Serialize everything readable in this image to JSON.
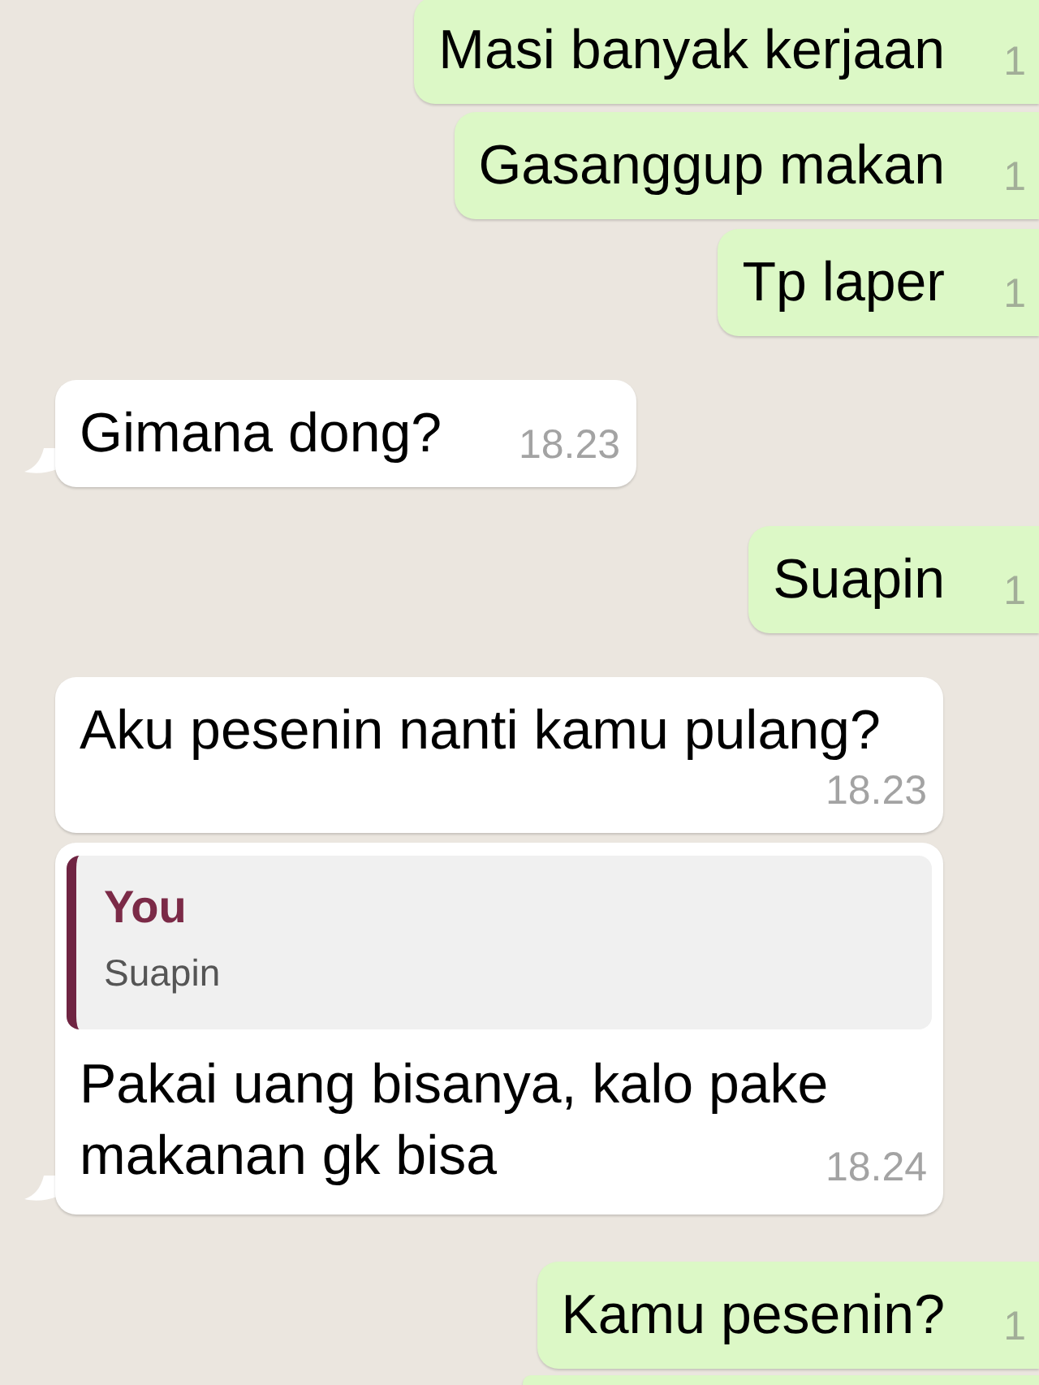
{
  "messages": [
    {
      "kind": "outgoing",
      "text": "Masi banyak kerjaan",
      "time": "1"
    },
    {
      "kind": "outgoing",
      "text": "Gasanggup makan",
      "time": "1"
    },
    {
      "kind": "outgoing",
      "text": "Tp laper",
      "time": "1"
    },
    {
      "kind": "incoming",
      "text": "Gimana dong?",
      "time": "18.23",
      "tail": true
    },
    {
      "kind": "outgoing",
      "text": "Suapin",
      "time": "1"
    },
    {
      "kind": "incoming",
      "text": "Aku pesenin nanti kamu pulang?",
      "time": "18.23",
      "tail": false
    },
    {
      "kind": "incoming",
      "quote": {
        "author": "You",
        "text": "Suapin"
      },
      "text": "Pakai uang bisanya,  kalo pake makanan gk bisa",
      "time": "18.24",
      "tail": true
    },
    {
      "kind": "outgoing",
      "text": "Kamu pesenin?",
      "time": "1"
    },
    {
      "kind": "outgoing"
    }
  ]
}
